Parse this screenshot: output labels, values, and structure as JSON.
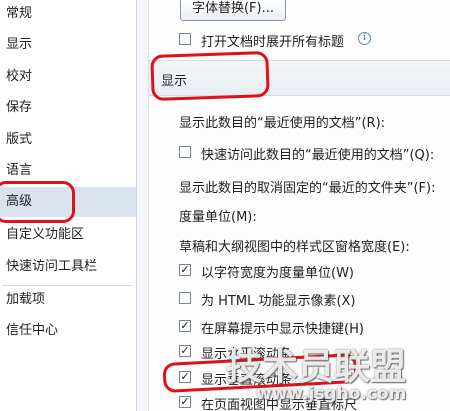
{
  "sidebar": {
    "items": [
      {
        "label": "常规"
      },
      {
        "label": "显示"
      },
      {
        "label": "校对"
      },
      {
        "label": "保存"
      },
      {
        "label": "版式"
      },
      {
        "label": "语言"
      },
      {
        "label": "高级"
      },
      {
        "label": "自定义功能区"
      },
      {
        "label": "快速访问工具栏"
      },
      {
        "label": "加载项"
      },
      {
        "label": "信任中心"
      }
    ]
  },
  "main": {
    "font_substitution_button": "字体替换(F)...",
    "expand_headings_label": "打开文档时展开所有标题",
    "display_section_header": "显示",
    "recent_docs_label": "显示此数目的“最近使用的文档”(R):",
    "quick_access_recent_label": "快速访问此数目的“最近使用的文档”(Q):",
    "unpinned_folders_label": "显示此数目的取消固定的“最近的文件夹”(F):",
    "measure_unit_label": "度量单位(M):",
    "style_area_width_label": "草稿和大纲视图中的样式区窗格宽度(E):",
    "options": [
      {
        "label": "以字符宽度为度量单位(W)",
        "checked": true
      },
      {
        "label": "为 HTML 功能显示像素(X)",
        "checked": false
      },
      {
        "label": "在屏幕提示中显示快捷键(H)",
        "checked": true
      },
      {
        "label": "显示水平滚动条",
        "checked": true
      },
      {
        "label": "显示垂直滚动条",
        "checked": true
      },
      {
        "label": "在页面视图中显示垂直标尺",
        "checked": true
      }
    ]
  },
  "watermark": {
    "brand": "技术员联盟",
    "url": "www.jsgho.com"
  },
  "colors": {
    "annotation_red": "#e0101a",
    "selected_bg": "#dbe3ef"
  }
}
